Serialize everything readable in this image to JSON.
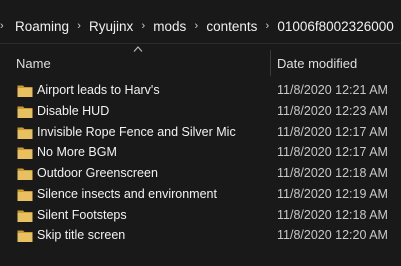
{
  "breadcrumb": {
    "items": [
      "Roaming",
      "Ryujinx",
      "mods",
      "contents",
      "01006f8002326000"
    ]
  },
  "columns": {
    "name": "Name",
    "date_modified": "Date modified"
  },
  "files": [
    {
      "name": "Airport leads to Harv's",
      "date": "11/8/2020 12:21 AM",
      "icon": "folder-icon"
    },
    {
      "name": "Disable HUD",
      "date": "11/8/2020 12:23 AM",
      "icon": "folder-icon"
    },
    {
      "name": "Invisible Rope Fence and Silver Mic",
      "date": "11/8/2020 12:17 AM",
      "icon": "folder-icon"
    },
    {
      "name": "No More BGM",
      "date": "11/8/2020 12:17 AM",
      "icon": "folder-icon"
    },
    {
      "name": "Outdoor Greenscreen",
      "date": "11/8/2020 12:18 AM",
      "icon": "folder-icon"
    },
    {
      "name": "Silence insects and environment",
      "date": "11/8/2020 12:19 AM",
      "icon": "folder-icon"
    },
    {
      "name": "Silent Footsteps",
      "date": "11/8/2020 12:18 AM",
      "icon": "folder-icon"
    },
    {
      "name": "Skip title screen",
      "date": "11/8/2020 12:20 AM",
      "icon": "folder-icon"
    }
  ],
  "colors": {
    "background": "#191919",
    "folder": "#e8c060",
    "folder_dark": "#c99a2e",
    "text": "#f2f2f2"
  }
}
